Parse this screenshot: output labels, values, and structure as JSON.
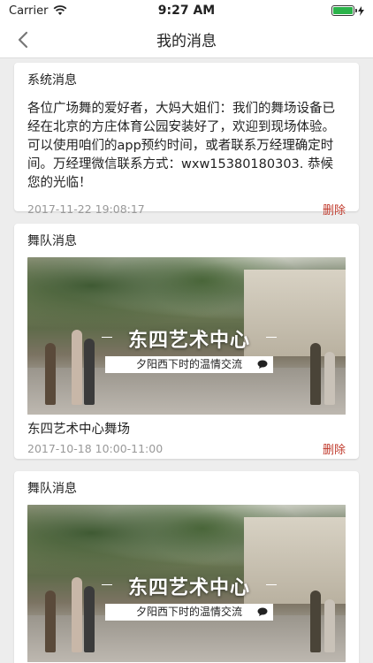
{
  "status_bar": {
    "carrier": "Carrier",
    "time": "9:27 AM"
  },
  "nav": {
    "title": "我的消息"
  },
  "cards": [
    {
      "type": "system",
      "title": "系统消息",
      "body": "各位广场舞的爱好者，大妈大姐们：我们的舞场设备已经在北京的方庄体育公园安装好了，欢迎到现场体验。可以使用咱们的app预约时间，或者联系万经理确定时间。万经理微信联系方式：wxw15380180303. 恭候您的光临！",
      "time": "2017-11-22 19:08:17",
      "delete_label": "删除"
    },
    {
      "type": "team",
      "title": "舞队消息",
      "banner_main": "东四艺术中心",
      "banner_sub": "夕阳西下时的温情交流",
      "name": "东四艺术中心舞场",
      "time": "2017-10-18 10:00-11:00",
      "delete_label": "删除"
    },
    {
      "type": "team",
      "title": "舞队消息",
      "banner_main": "东四艺术中心",
      "banner_sub": "夕阳西下时的温情交流"
    }
  ],
  "colors": {
    "accent_delete": "#c0392b",
    "battery": "#2bb34a"
  }
}
